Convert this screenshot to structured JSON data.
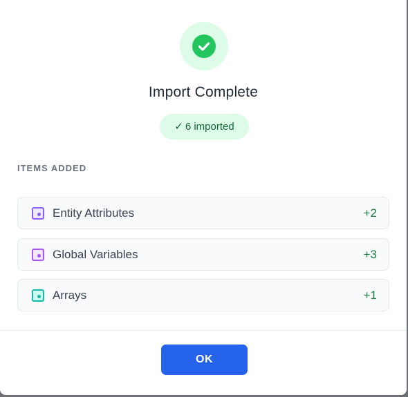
{
  "dialog": {
    "title": "Import Complete",
    "badge": {
      "check": "✓",
      "text": "6 imported"
    },
    "section_label": "ITEMS ADDED",
    "items": [
      {
        "label": "Entity Attributes",
        "count": "+2",
        "icon": "attribute-icon",
        "icon_color": "#8b5cf6"
      },
      {
        "label": "Global Variables",
        "count": "+3",
        "icon": "variable-icon",
        "icon_color": "#a855f7"
      },
      {
        "label": "Arrays",
        "count": "+1",
        "icon": "array-icon",
        "icon_color": "#14b8a6"
      }
    ],
    "ok_label": "OK"
  },
  "colors": {
    "success": "#22c55e",
    "success_bg": "#dcfce7",
    "badge_text": "#166534",
    "count_text": "#15803d",
    "primary_button": "#2563eb"
  }
}
